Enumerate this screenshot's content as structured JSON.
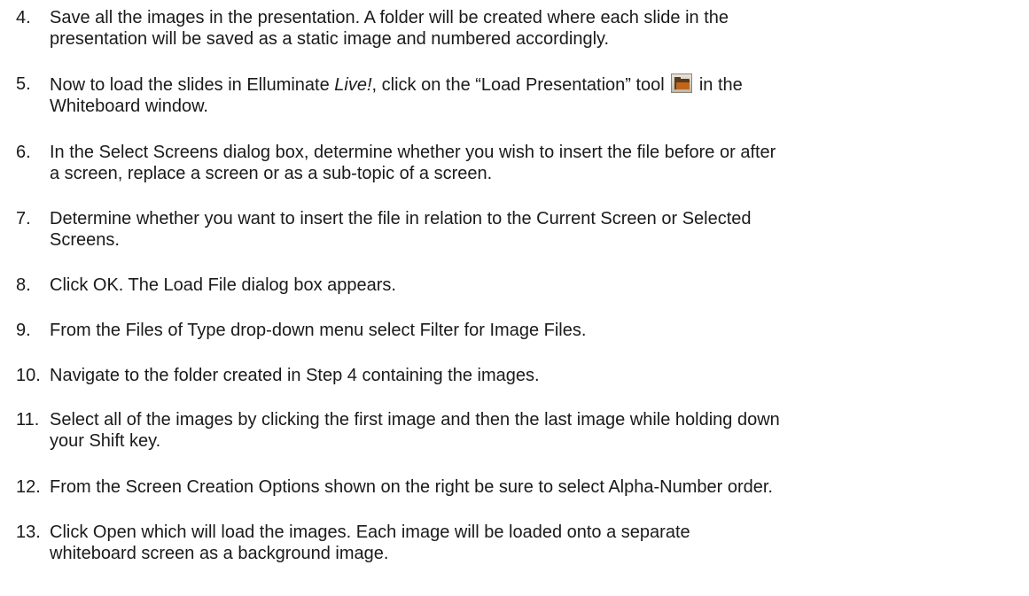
{
  "steps": [
    {
      "number": "4.",
      "lines": [
        "Save all the images in the presentation.  A folder will be created where each slide in the",
        "presentation will be saved as a static image and numbered accordingly."
      ]
    },
    {
      "number": "5.",
      "line1_before": "Now to load the slides in Elluminate ",
      "line1_italic": "Live!",
      "line1_middle": ", click on the “Load Presentation” tool ",
      "line1_after": " in the",
      "icon": "load-presentation-folder-icon",
      "lines": [
        "Whiteboard window."
      ]
    },
    {
      "number": "6.",
      "lines": [
        "In the Select Screens dialog box, determine whether you wish to insert the file before or after",
        "a screen, replace a screen or as a sub-topic of a screen."
      ]
    },
    {
      "number": "7.",
      "lines": [
        "Determine whether you want to insert the file in relation to the Current Screen or Selected",
        "Screens."
      ]
    },
    {
      "number": "8.",
      "lines": [
        "Click OK.  The Load File dialog box appears."
      ]
    },
    {
      "number": "9.",
      "lines": [
        "From the Files of Type drop-down menu select Filter for Image Files."
      ]
    },
    {
      "number": "10.",
      "lines": [
        "Navigate to the folder created in Step 4 containing the images."
      ]
    },
    {
      "number": "11.",
      "lines": [
        "Select all of the images by clicking the first image and then the last image while holding down",
        "your Shift key."
      ]
    },
    {
      "number": "12.",
      "lines": [
        "From the Screen Creation Options shown on the right be sure to select Alpha-Number order."
      ]
    },
    {
      "number": "13.",
      "lines": [
        "Click Open which will load the images.  Each image will be loaded onto a separate",
        "whiteboard screen as a background image."
      ]
    }
  ]
}
